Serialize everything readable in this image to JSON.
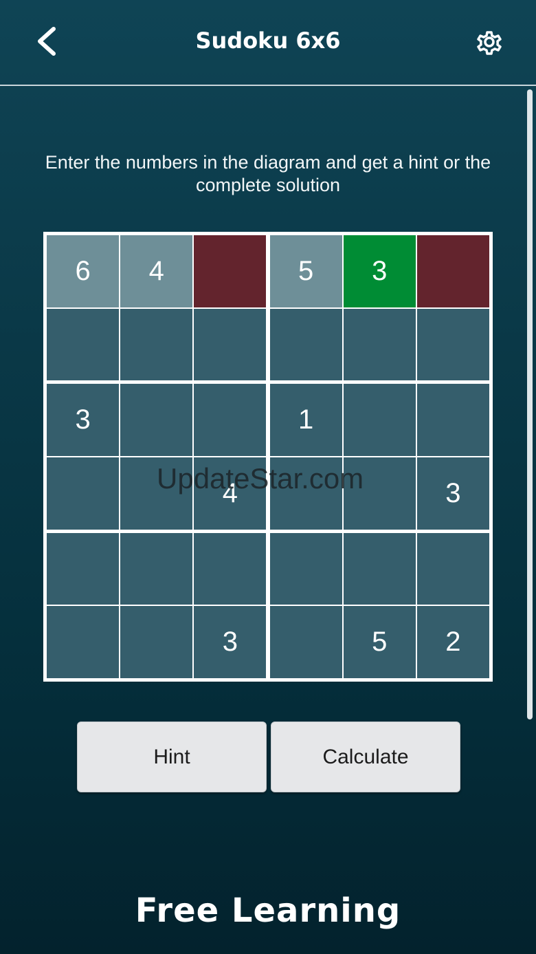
{
  "header": {
    "title": "Sudoku 6x6",
    "back_icon": "chevron-left-icon",
    "settings_icon": "gear-icon"
  },
  "instructions": "Enter the numbers in the diagram and get a hint or the complete solution",
  "grid": {
    "size": 6,
    "box_rows": 2,
    "box_cols": 3,
    "cells": [
      [
        "6",
        "4",
        "",
        "5",
        "3",
        ""
      ],
      [
        "",
        "",
        "",
        "",
        "",
        ""
      ],
      [
        "3",
        "",
        "",
        "1",
        "",
        ""
      ],
      [
        "",
        "",
        "4",
        "",
        "",
        "3"
      ],
      [
        "",
        "",
        "",
        "",
        "",
        ""
      ],
      [
        "",
        "",
        "3",
        "",
        "5",
        "2"
      ]
    ],
    "states": [
      [
        "given",
        "given",
        "error",
        "given",
        "hint",
        "error"
      ],
      [
        "normal",
        "normal",
        "normal",
        "normal",
        "normal",
        "normal"
      ],
      [
        "normal",
        "normal",
        "normal",
        "normal",
        "normal",
        "normal"
      ],
      [
        "normal",
        "normal",
        "normal",
        "normal",
        "normal",
        "normal"
      ],
      [
        "normal",
        "normal",
        "normal",
        "normal",
        "normal",
        "normal"
      ],
      [
        "normal",
        "normal",
        "normal",
        "normal",
        "normal",
        "normal"
      ]
    ]
  },
  "colors": {
    "cell_normal": "#355e6c",
    "cell_given": "#6e8f98",
    "cell_error": "#63242d",
    "cell_hint": "#008c34"
  },
  "watermark": "UpdateStar.com",
  "buttons": {
    "hint": "Hint",
    "calculate": "Calculate"
  },
  "brand": "Free Learning"
}
